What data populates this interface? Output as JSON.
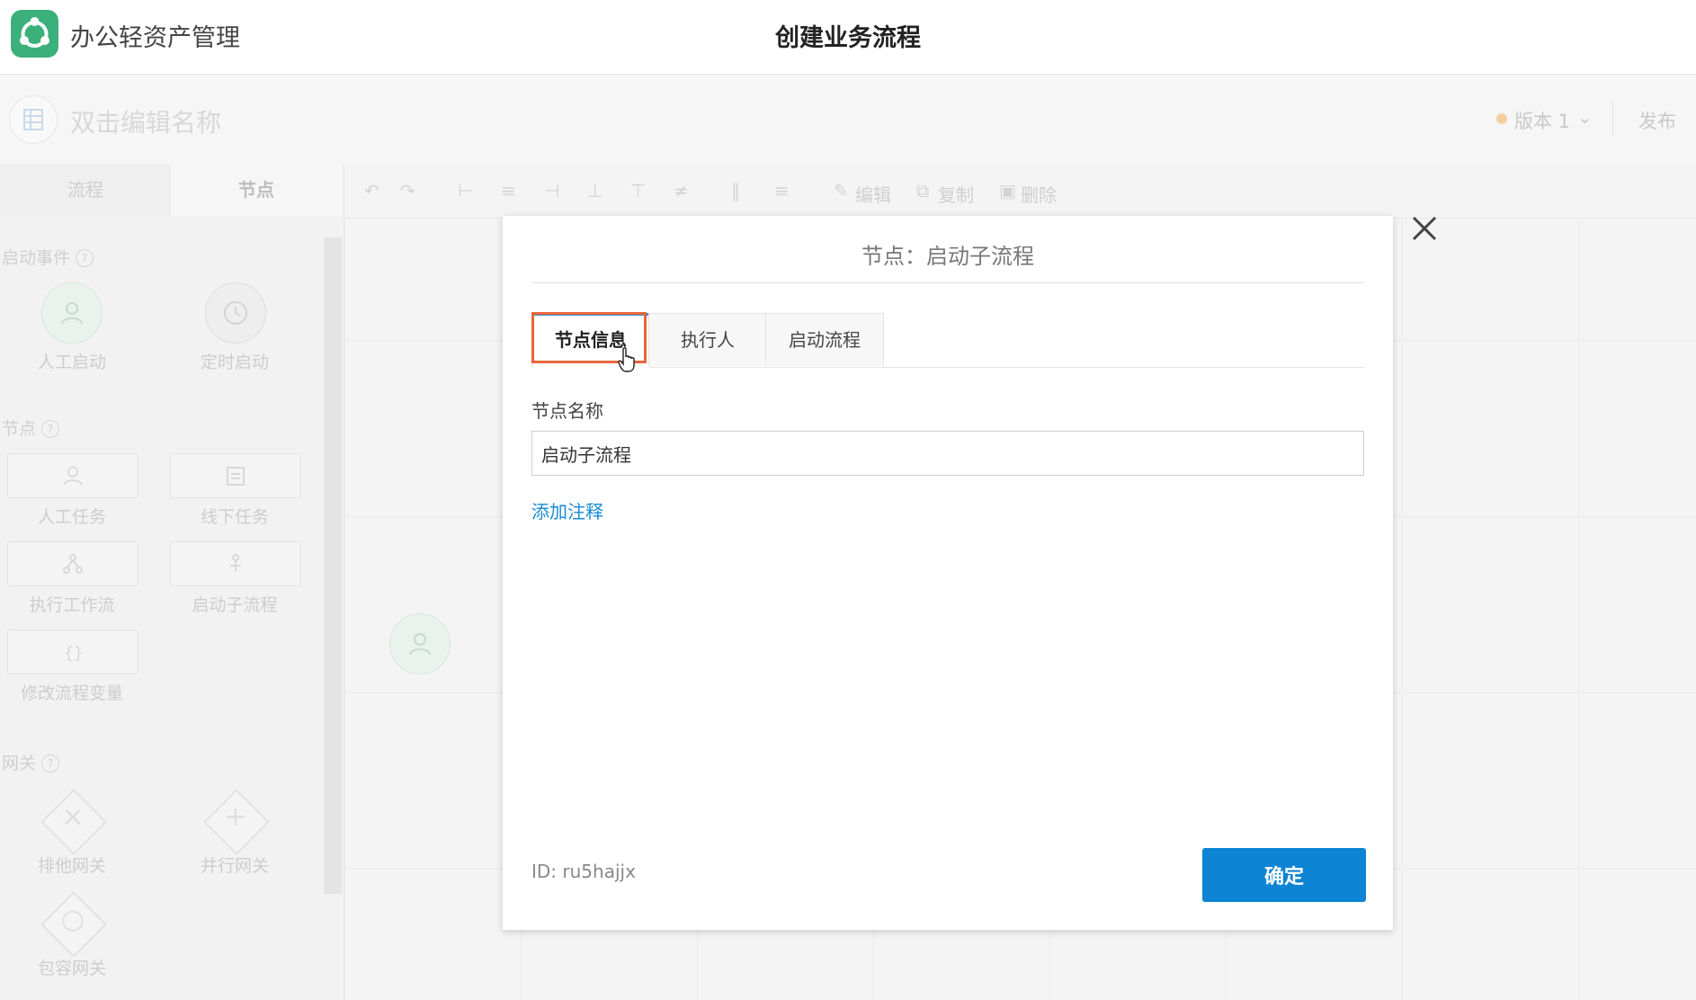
{
  "app": {
    "name": "办公轻资产管理",
    "page_title": "创建业务流程"
  },
  "editor": {
    "flow_name_placeholder": "双击编辑名称",
    "version_label": "版本 1",
    "publish_label": "发布",
    "sidebar_tabs": [
      "流程",
      "节点"
    ],
    "sections": {
      "start_events": "启动事件",
      "nodes": "节点",
      "gateways": "网关"
    },
    "start_items": [
      "人工启动",
      "定时启动"
    ],
    "node_items": [
      "人工任务",
      "线下任务",
      "执行工作流",
      "启动子流程",
      "修改流程变量"
    ],
    "gateway_items": [
      "排他网关",
      "并行网关",
      "包容网关"
    ],
    "toolbar": {
      "edit": "编辑",
      "copy": "复制",
      "delete": "删除"
    }
  },
  "modal": {
    "title": "节点：启动子流程",
    "tabs": [
      "节点信息",
      "执行人",
      "启动流程"
    ],
    "field_label": "节点名称",
    "field_value": "启动子流程",
    "add_note": "添加注释",
    "node_id": "ID: ru5hajjx",
    "confirm_label": "确定"
  },
  "colors": {
    "brand_green": "#3bb07a",
    "primary_blue": "#0d84d4",
    "link_blue": "#1a8ad4",
    "highlight_orange": "#e8663d"
  }
}
